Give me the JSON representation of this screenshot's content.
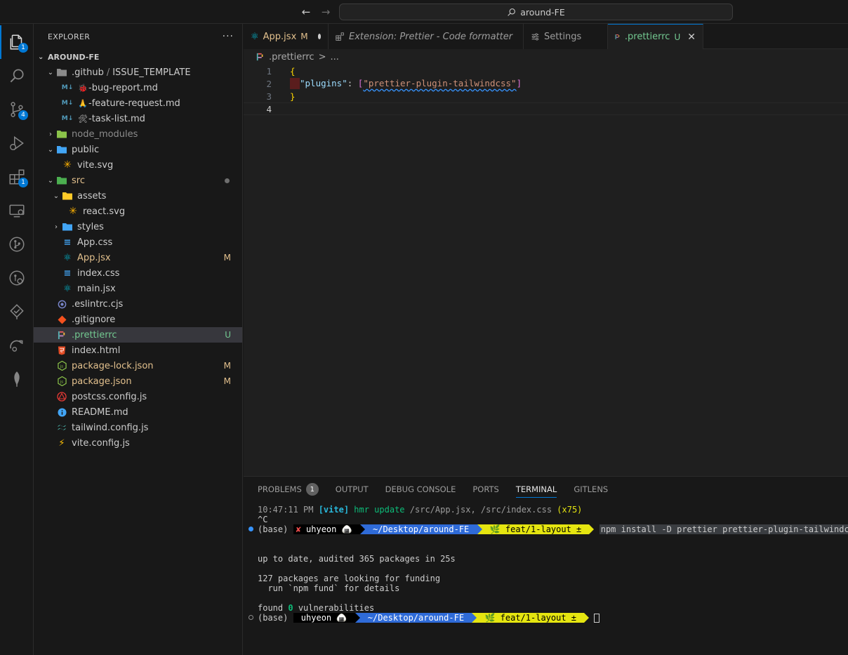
{
  "titlebar": {
    "back_icon": "arrow-left-icon",
    "forward_icon": "arrow-right-icon",
    "search_text": "around-FE"
  },
  "activity": {
    "explorer_badge": "1",
    "scm_badge": "4",
    "extensions_badge": "1"
  },
  "sidebar": {
    "title": "EXPLORER",
    "more": "···",
    "root": "AROUND-FE",
    "items": [
      {
        "label": ".github",
        "sub": "ISSUE_TEMPLATE"
      },
      {
        "label": "-bug-report.md"
      },
      {
        "label": "-feature-request.md"
      },
      {
        "label": "-task-list.md"
      },
      {
        "label": "node_modules"
      },
      {
        "label": "public"
      },
      {
        "label": "vite.svg"
      },
      {
        "label": "src"
      },
      {
        "label": "assets"
      },
      {
        "label": "react.svg"
      },
      {
        "label": "styles"
      },
      {
        "label": "App.css"
      },
      {
        "label": "App.jsx",
        "status": "M"
      },
      {
        "label": "index.css"
      },
      {
        "label": "main.jsx"
      },
      {
        "label": ".eslintrc.cjs"
      },
      {
        "label": ".gitignore"
      },
      {
        "label": ".prettierrc",
        "status": "U"
      },
      {
        "label": "index.html"
      },
      {
        "label": "package-lock.json",
        "status": "M"
      },
      {
        "label": "package.json",
        "status": "M"
      },
      {
        "label": "postcss.config.js"
      },
      {
        "label": "README.md"
      },
      {
        "label": "tailwind.config.js"
      },
      {
        "label": "vite.config.js"
      }
    ]
  },
  "tabs": [
    {
      "label": "App.jsx",
      "status": "M"
    },
    {
      "label": "Extension: Prettier - Code formatter"
    },
    {
      "label": "Settings"
    },
    {
      "label": ".prettierrc",
      "status": "U"
    }
  ],
  "breadcrumb": {
    "file": ".prettierrc",
    "sep": ">",
    "more": "..."
  },
  "editor": {
    "line_numbers": [
      "1",
      "2",
      "3",
      "4"
    ],
    "open_brace": "{",
    "key": "\"plugins\"",
    "colon": ": ",
    "open_bracket": "[",
    "value": "\"prettier-plugin-tailwindcss\"",
    "close_bracket": "]",
    "close_brace": "}"
  },
  "panel": {
    "tabs": [
      {
        "label": "PROBLEMS",
        "badge": "1"
      },
      {
        "label": "OUTPUT"
      },
      {
        "label": "DEBUG CONSOLE"
      },
      {
        "label": "PORTS"
      },
      {
        "label": "TERMINAL"
      },
      {
        "label": "GITLENS"
      }
    ],
    "terminal": {
      "l1_time": "10:47:11 PM ",
      "l1_vite": "[vite]",
      "l1_hmr": " hmr update ",
      "l1_paths": "/src/App.jsx, /src/index.css ",
      "l1_count": "(x75)",
      "l2": "^C",
      "base": "(base) ",
      "x_mark": "✘",
      "user": " uhyeon 🍙 ",
      "path": " ~/Desktop/around-FE ",
      "branch": " 🌿 feat/1-layout ± ",
      "command": "npm install -D prettier prettier-plugin-tailwindcss",
      "l5": "up to date, audited 365 packages in 25s",
      "l7": "127 packages are looking for funding",
      "l8": "  run `npm fund` for details",
      "l10_a": "found ",
      "l10_b": "0",
      "l10_c": " vulnerabilities"
    }
  }
}
